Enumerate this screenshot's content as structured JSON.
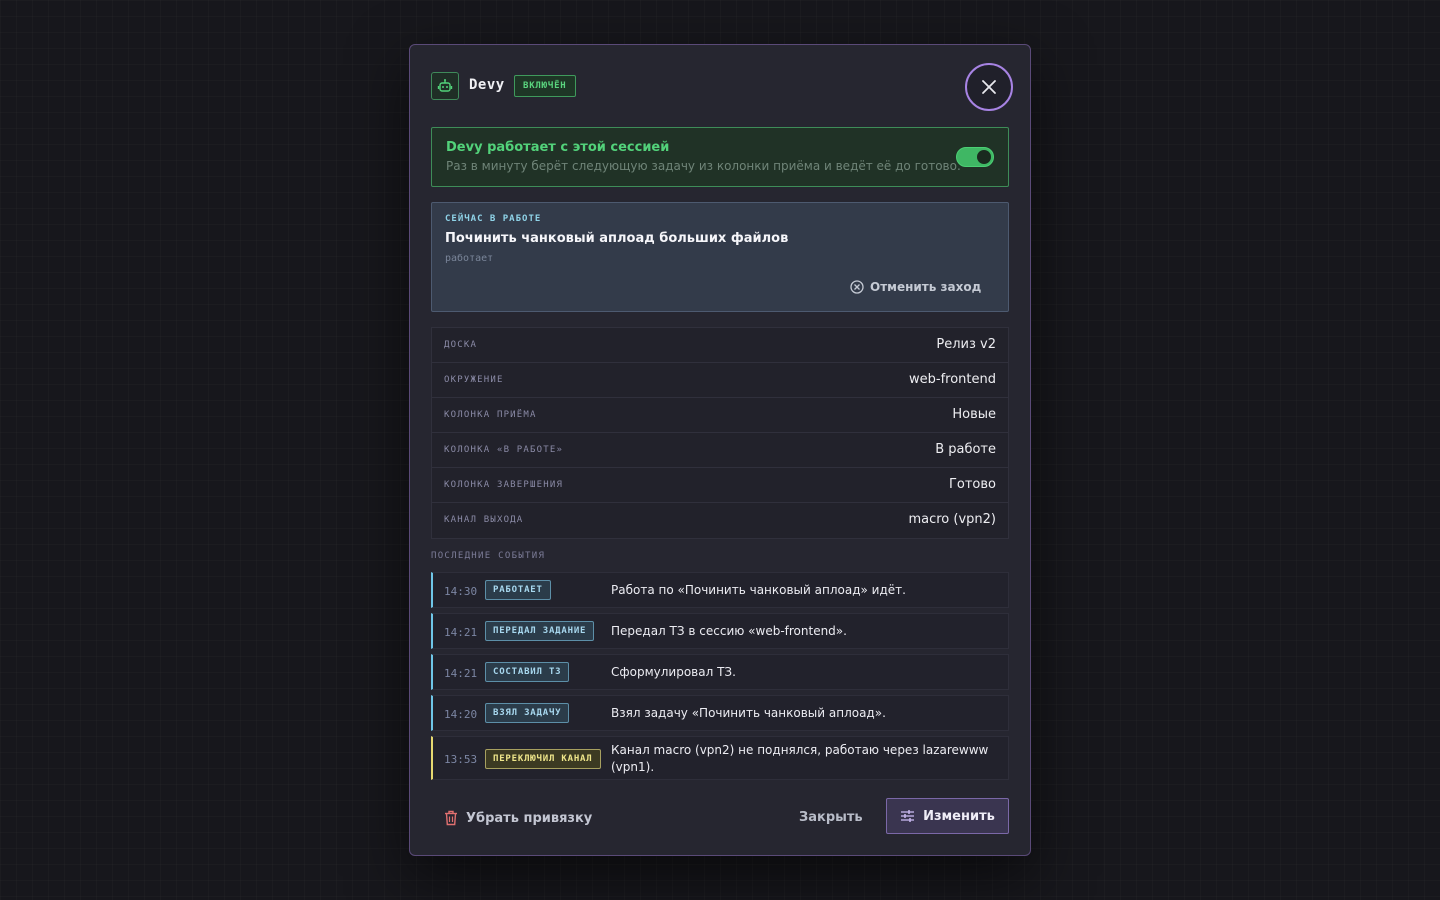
{
  "header": {
    "title": "Devy",
    "status_badge": "ВКЛЮЧЁН"
  },
  "session": {
    "title": "Devy работает с этой сессией",
    "description": "Раз в минуту берёт следующую задачу из колонки приёма и ведёт её до готово.",
    "toggle_on": true
  },
  "current_work": {
    "label": "СЕЙЧАС В РАБОТЕ",
    "task": "Починить чанковый аплоад больших файлов",
    "status": "работает",
    "cancel_label": "Отменить заход"
  },
  "props": [
    {
      "key": "ДОСКА",
      "value": "Релиз v2"
    },
    {
      "key": "ОКРУЖЕНИЕ",
      "value": "web-frontend"
    },
    {
      "key": "КОЛОНКА ПРИЁМА",
      "value": "Новые"
    },
    {
      "key": "КОЛОНКА «В РАБОТЕ»",
      "value": "В работе"
    },
    {
      "key": "КОЛОНКА ЗАВЕРШЕНИЯ",
      "value": "Готово"
    },
    {
      "key": "КАНАЛ ВЫХОДА",
      "value": "macro (vpn2)"
    }
  ],
  "events_label": "ПОСЛЕДНИЕ СОБЫТИЯ",
  "events": [
    {
      "time": "14:30",
      "tag": "РАБОТАЕТ",
      "text": "Работа по «Починить чанковый аплоад» идёт."
    },
    {
      "time": "14:21",
      "tag": "ПЕРЕДАЛ ЗАДАНИЕ",
      "text": "Передал ТЗ в сессию «web-frontend»."
    },
    {
      "time": "14:21",
      "tag": "СОСТАВИЛ ТЗ",
      "text": "Сформулировал ТЗ."
    },
    {
      "time": "14:20",
      "tag": "ВЗЯЛ ЗАДАЧУ",
      "text": "Взял задачу «Починить чанковый аплоад»."
    },
    {
      "time": "13:53",
      "tag": "ПЕРЕКЛЮЧИЛ КАНАЛ",
      "text": "Канал macro (vpn2) не поднялся, работаю через lazarewww (vpn1)."
    }
  ],
  "footer": {
    "unlink_label": "Убрать привязку",
    "close_label": "Закрыть",
    "edit_label": "Изменить"
  },
  "colors": {
    "accent": "#a783e3",
    "success": "#52d27a",
    "info": "#6fc6e8",
    "warning": "#e6d870"
  },
  "icons": {
    "bot": "robot-icon",
    "close": "close-icon",
    "cancel": "circle-x-icon",
    "trash": "trash-icon",
    "edit": "sliders-icon"
  }
}
